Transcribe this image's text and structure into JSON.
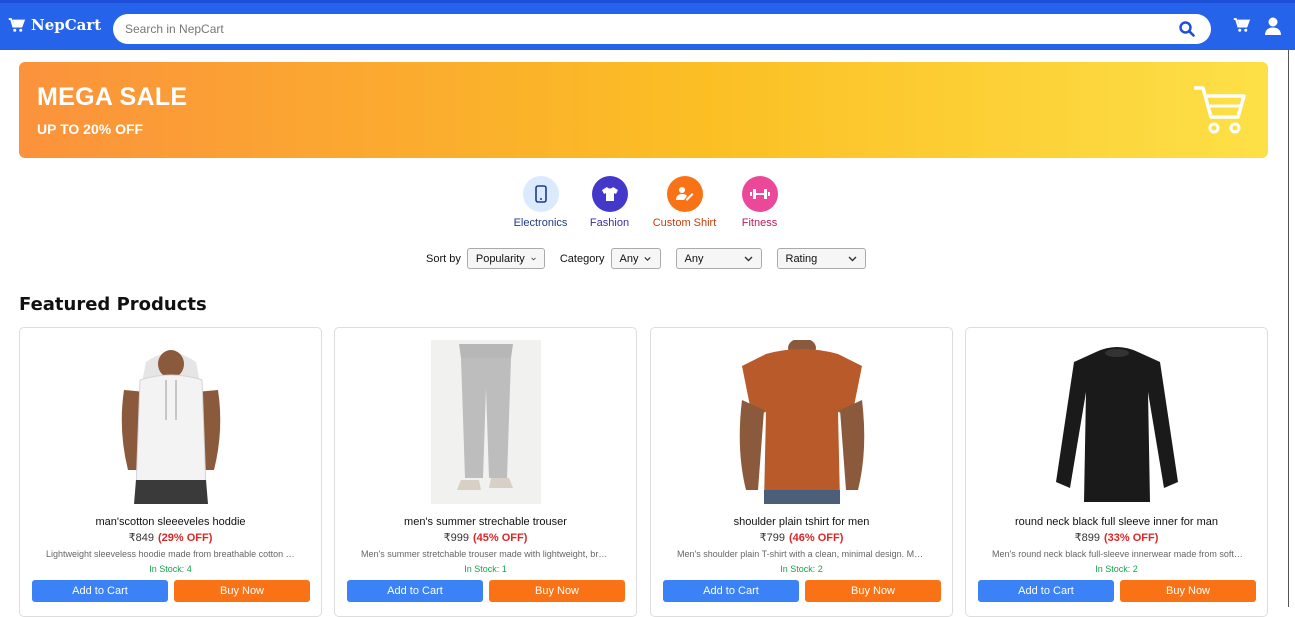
{
  "header": {
    "brand": "NepCart",
    "search_placeholder": "Search in NepCart"
  },
  "banner": {
    "title": "MEGA SALE",
    "subtitle": "UP TO 20% OFF"
  },
  "categories": [
    {
      "label": "Electronics",
      "icon": "phone-icon",
      "bg": "#dbeafe",
      "fg": "#1e3a8a",
      "text": "#1e3a8a"
    },
    {
      "label": "Fashion",
      "icon": "tshirt-icon",
      "bg": "#4338ca",
      "fg": "#ffffff",
      "text": "#3730a3"
    },
    {
      "label": "Custom Shirt",
      "icon": "edit-user-icon",
      "bg": "#f97316",
      "fg": "#ffffff",
      "text": "#c2410c"
    },
    {
      "label": "Fitness",
      "icon": "dumbbell-icon",
      "bg": "#ec4899",
      "fg": "#ffffff",
      "text": "#be185d"
    }
  ],
  "filters": {
    "sort_label": "Sort by",
    "sort_value": "Popularity",
    "category_label": "Category",
    "category_value": "Any",
    "sub_value": "Any",
    "rating_value": "Rating"
  },
  "section_title": "Featured Products",
  "products": [
    {
      "name": "man'scotton sleeeveles hoddie",
      "price": "₹849",
      "off": "(29% OFF)",
      "desc": "Lightweight sleeveless hoodie made from breathable cotton blend fabric",
      "stock": "In Stock: 4",
      "add": "Add to Cart",
      "buy": "Buy Now"
    },
    {
      "name": "men's summer strechable trouser",
      "price": "₹999",
      "off": "(45% OFF)",
      "desc": "Men's summer stretchable trouser made with lightweight, breathable fabric",
      "stock": "In Stock: 1",
      "add": "Add to Cart",
      "buy": "Buy Now"
    },
    {
      "name": "shoulder plain tshirt for men",
      "price": "₹799",
      "off": "(46% OFF)",
      "desc": "Men's shoulder plain T-shirt with a clean, minimal design. Made from soft cotton",
      "stock": "In Stock: 2",
      "add": "Add to Cart",
      "buy": "Buy Now"
    },
    {
      "name": "round neck black full sleeve inner for man",
      "price": "₹899",
      "off": "(33% OFF)",
      "desc": "Men's round neck black full-sleeve innerwear made from soft, stretchable fabric",
      "stock": "In Stock: 2",
      "add": "Add to Cart",
      "buy": "Buy Now"
    }
  ],
  "colors": {
    "primary": "#2563eb",
    "accent": "#f97316",
    "button_blue": "#3b82f6",
    "sale": "#dc2626",
    "stock": "#16a34a"
  }
}
